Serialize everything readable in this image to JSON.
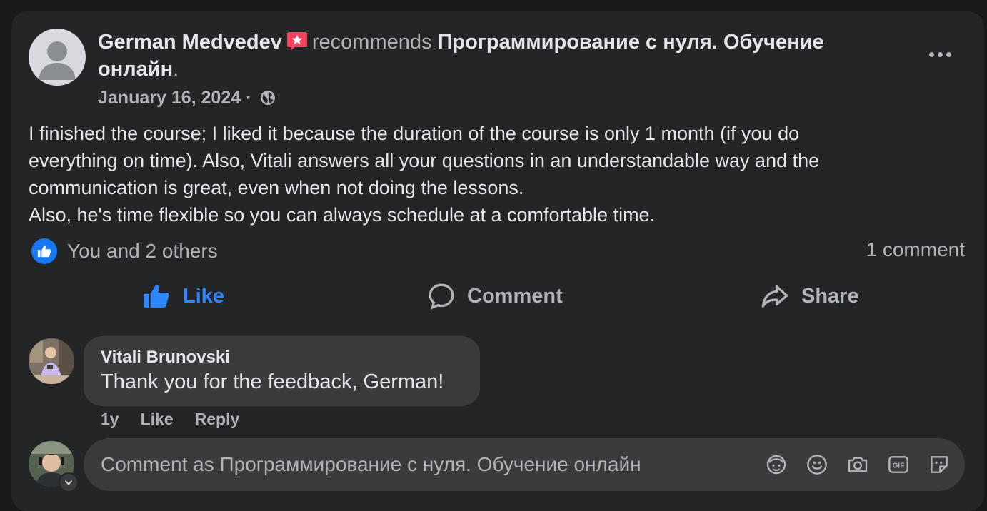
{
  "post": {
    "author": "German Medvedev",
    "recommends_text": "recommends",
    "page_name": "Программирование с нуля. Обучение онлайн",
    "trailing_punct": ".",
    "date": "January 16, 2024",
    "separator": "·",
    "privacy_icon": "globe-icon",
    "body_lines": [
      "I finished the course; I liked it because the duration of the course is only 1 month (if you do",
      "everything on time). Also, Vitali answers all your questions in an understandable way and the",
      "communication is great, even when not doing the lessons.",
      "Also, he's time flexible so you can always schedule at a comfortable time."
    ]
  },
  "reactions": {
    "summary": "You and 2 others",
    "comment_count": "1 comment"
  },
  "actions": {
    "like": "Like",
    "comment": "Comment",
    "share": "Share"
  },
  "comment": {
    "author": "Vitali Brunovski",
    "text": "Thank you for the feedback, German!",
    "age": "1y",
    "like": "Like",
    "reply": "Reply"
  },
  "composer": {
    "placeholder": "Comment as Программирование с нуля. Обучение онлайн",
    "icons": [
      "avatar-sticker-icon",
      "emoji-icon",
      "camera-icon",
      "gif-icon",
      "sticker-icon"
    ]
  },
  "colors": {
    "background": "#18191a",
    "card": "#242526",
    "bubble": "#3a3b3c",
    "primary_text": "#e4e6eb",
    "secondary_text": "#b0b3b8",
    "like_blue": "#2d88ff",
    "recommend_badge": "#f3425f"
  }
}
